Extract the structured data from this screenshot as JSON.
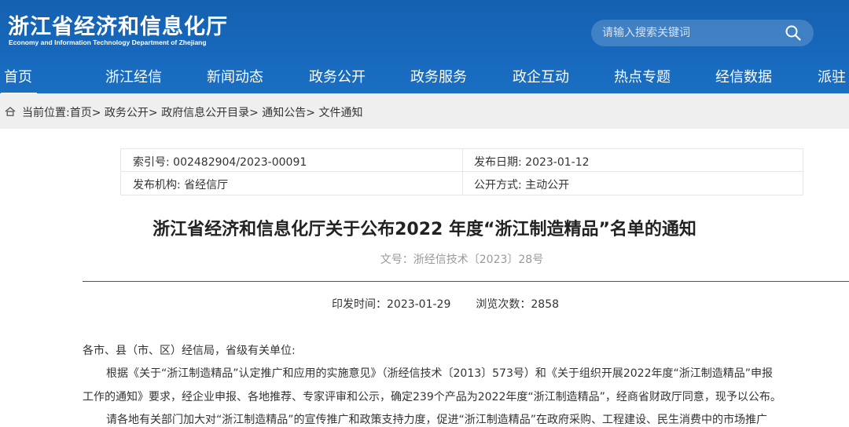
{
  "header": {
    "site_title": "浙江省经济和信息化厅",
    "site_subtitle": "Economy and Information Technology Department of Zhejiang",
    "search_placeholder": "请输入搜索关键词",
    "colors": {
      "header_bg": "#1769bd",
      "breadcrumb_bg": "#efefef"
    }
  },
  "nav": {
    "items": [
      {
        "label": "首页",
        "active": true
      },
      {
        "label": "浙江经信"
      },
      {
        "label": "新闻动态"
      },
      {
        "label": "政务公开"
      },
      {
        "label": "政务服务"
      },
      {
        "label": "政企互动"
      },
      {
        "label": "热点专题"
      },
      {
        "label": "经信数据"
      },
      {
        "label": "派驻"
      }
    ]
  },
  "breadcrumb": {
    "prefix": "当前位置:",
    "items": [
      "首页",
      "政务公开",
      "政府信息公开目录",
      "通知公告",
      "文件通知"
    ],
    "separator": ">"
  },
  "meta": {
    "index_no": "索引号: 002482904/2023-00091",
    "publish_date": "发布日期: 2023-01-12",
    "publisher": "发布机构: 省经信厅",
    "disclosure": "公开方式: 主动公开"
  },
  "document": {
    "title": "浙江省经济和信息化厅关于公布2022 年度“浙江制造精品”名单的通知",
    "doc_number": "文号：浙经信技术〔2023〕28号",
    "issue_time": "印发时间：2023-01-29",
    "views": "浏览次数：2858",
    "paragraphs": [
      "各市、县（市、区）经信局，省级有关单位:",
      "根据《关于“浙江制造精品”认定推广和应用的实施意见》（浙经信技术〔2013〕573号）和《关于组织开展2022年度“浙江制造精品”申报",
      "工作的通知》要求，经企业申报、各地推荐、专家评审和公示，确定239个产品为2022年度“浙江制造精品”，经商省财政厅同意，现予以公布。",
      "请各地有关部门加大对“浙江制造精品”的宣传推广和政策支持力度，促进“浙江制造精品”在政府采购、工程建设、民生消费中的市场推广"
    ]
  }
}
